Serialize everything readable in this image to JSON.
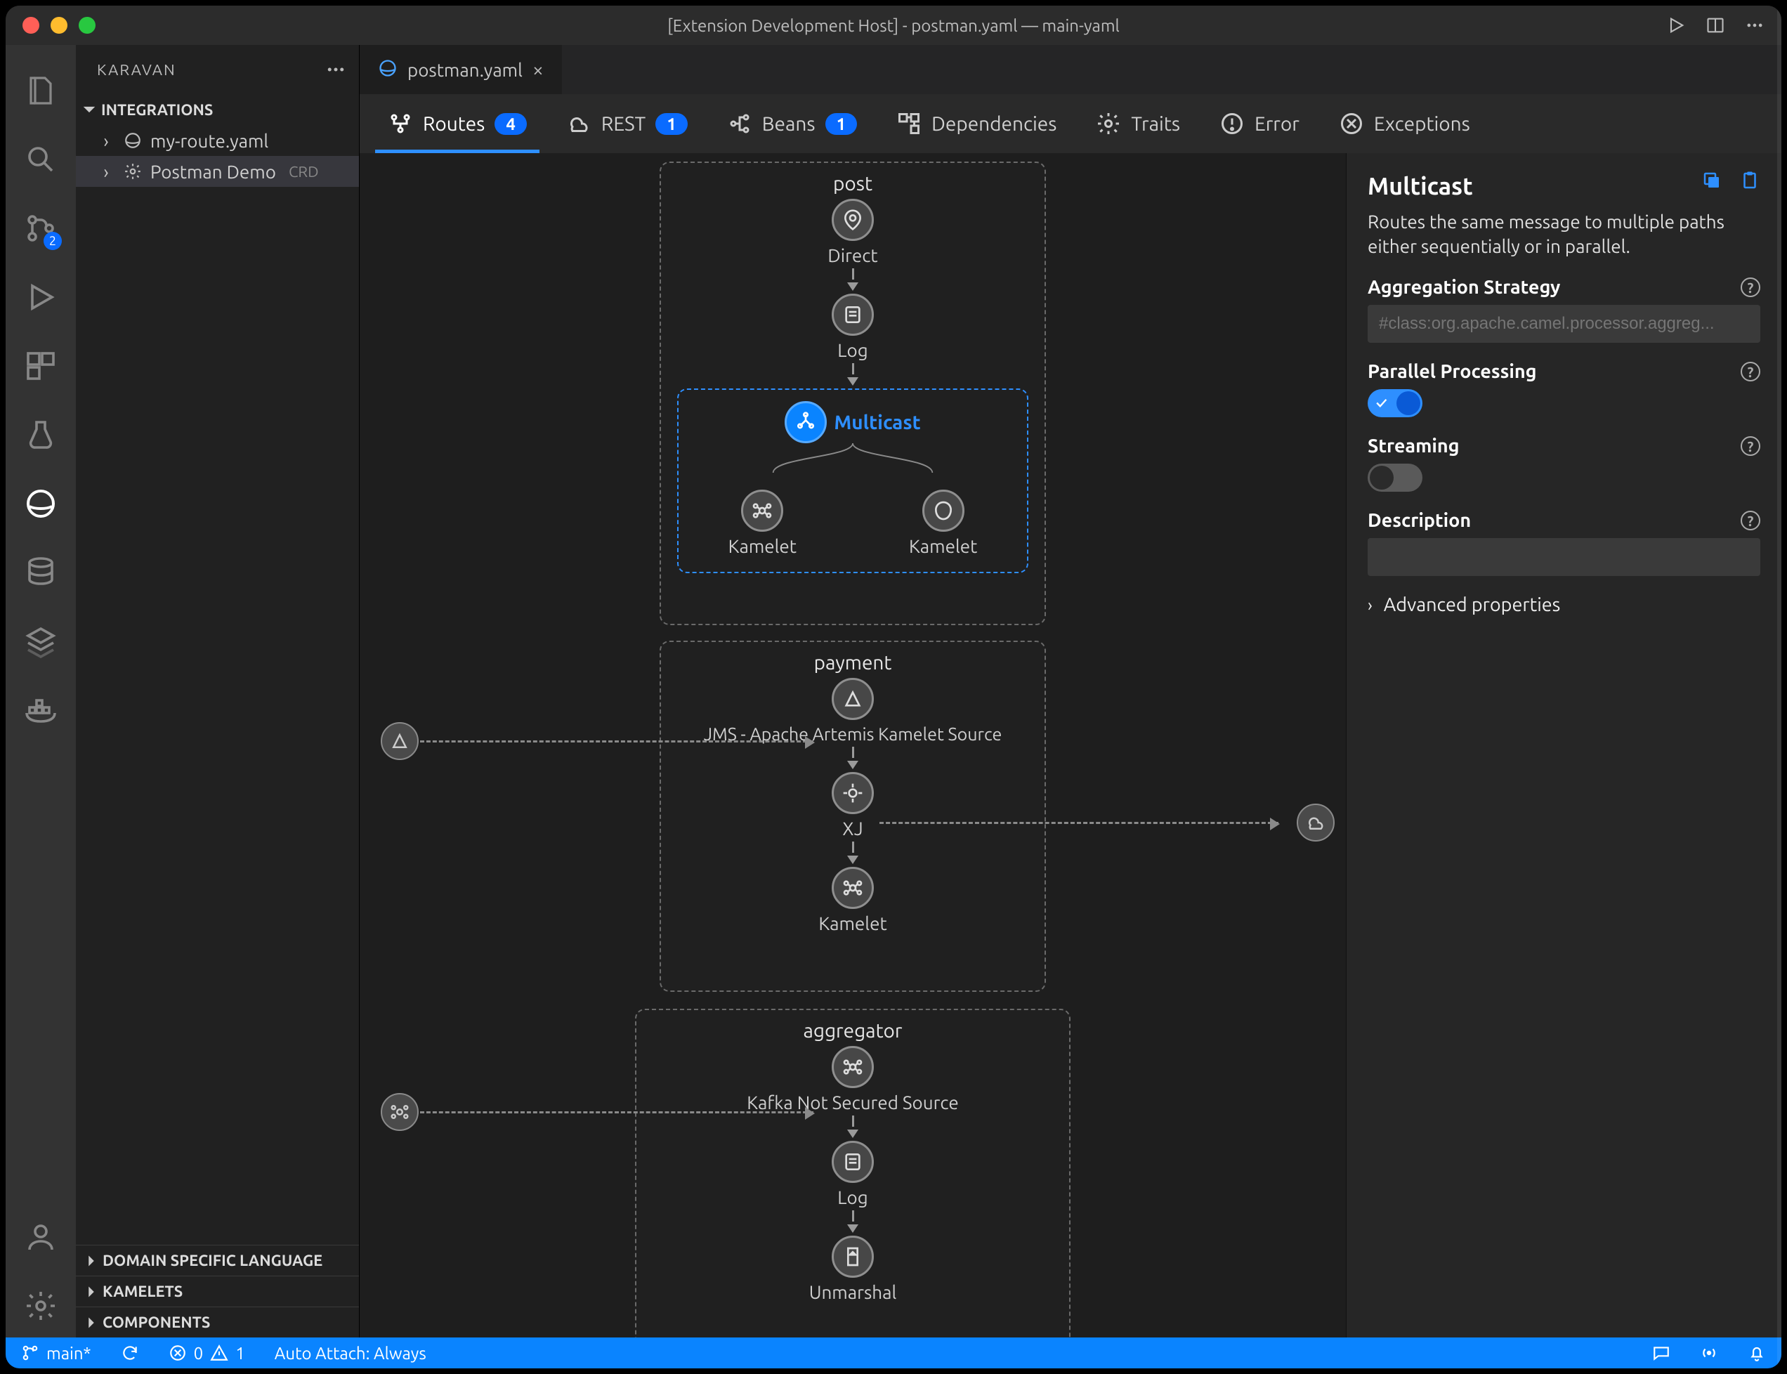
{
  "window": {
    "title": "[Extension Development Host] - postman.yaml — main-yaml"
  },
  "activity_bar": {
    "source_control_badge": "2"
  },
  "sidebar": {
    "title": "KARAVAN",
    "sections": {
      "integrations": {
        "label": "INTEGRATIONS",
        "items": [
          {
            "label": "my-route.yaml",
            "suffix": ""
          },
          {
            "label": "Postman Demo",
            "suffix": "CRD"
          }
        ]
      },
      "collapsed": [
        "DOMAIN SPECIFIC LANGUAGE",
        "KAMELETS",
        "COMPONENTS"
      ]
    }
  },
  "tabs": [
    {
      "label": "postman.yaml",
      "active": true
    }
  ],
  "ktabs": {
    "routes": {
      "label": "Routes",
      "count": "4"
    },
    "rest": {
      "label": "REST",
      "count": "1"
    },
    "beans": {
      "label": "Beans",
      "count": "1"
    },
    "dependencies": {
      "label": "Dependencies"
    },
    "traits": {
      "label": "Traits"
    },
    "error": {
      "label": "Error"
    },
    "exceptions": {
      "label": "Exceptions"
    }
  },
  "routes": {
    "post": {
      "title": "post",
      "nodes": {
        "direct": "Direct",
        "log": "Log",
        "multicast": "Multicast",
        "kamelet_a": "Kamelet",
        "kamelet_b": "Kamelet"
      }
    },
    "payment": {
      "title": "payment",
      "nodes": {
        "source": "JMS - Apache Artemis Kamelet Source",
        "xj": "XJ",
        "kamelet": "Kamelet"
      }
    },
    "aggregator": {
      "title": "aggregator",
      "nodes": {
        "source": "Kafka Not Secured Source",
        "log": "Log",
        "unmarshal": "Unmarshal"
      }
    }
  },
  "props": {
    "title": "Multicast",
    "description": "Routes the same message to multiple paths either sequentially or in parallel.",
    "aggregation_label": "Aggregation Strategy",
    "aggregation_placeholder": "#class:org.apache.camel.processor.aggreg...",
    "parallel_label": "Parallel Processing",
    "parallel_on": true,
    "streaming_label": "Streaming",
    "streaming_on": false,
    "description_label": "Description",
    "advanced_label": "Advanced properties"
  },
  "statusbar": {
    "branch": "main*",
    "errors": "0",
    "warnings": "1",
    "auto_attach": "Auto Attach: Always"
  }
}
